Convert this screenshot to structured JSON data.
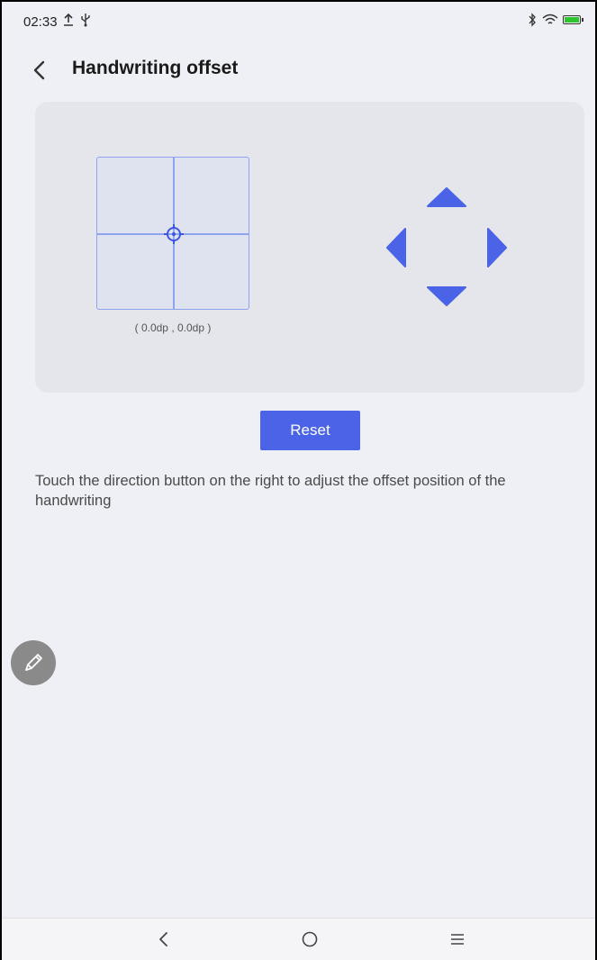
{
  "status_bar": {
    "time": "02:33",
    "icons": [
      "upload-icon",
      "usb-icon",
      "bluetooth-icon",
      "wifi-icon",
      "battery-icon"
    ]
  },
  "header": {
    "title": "Handwriting offset",
    "back_icon": "chevron-left-icon"
  },
  "offset_panel": {
    "coordinates": "( 0.0dp , 0.0dp )",
    "dpad": [
      "up",
      "left",
      "right",
      "down"
    ]
  },
  "reset_label": "Reset",
  "description": "Touch the direction button on the right to adjust the offset position of the handwriting",
  "nav_bar": [
    "back-icon",
    "home-icon",
    "menu-icon"
  ],
  "colors": {
    "accent": "#4a63e7",
    "panel_bg": "#e5e6ec",
    "page_bg": "#eef0f5",
    "pad_line": "#8fa4ef"
  }
}
